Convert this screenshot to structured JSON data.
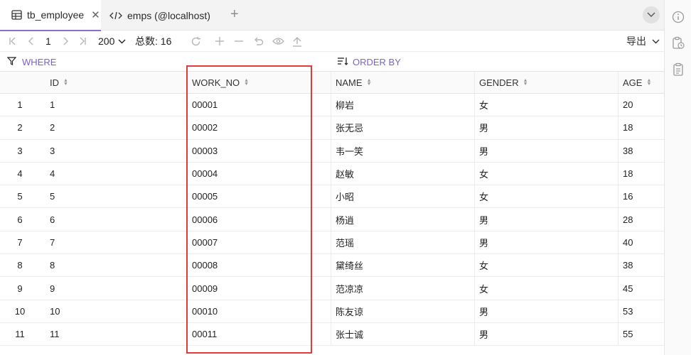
{
  "tabs": [
    {
      "label": "tb_employee",
      "icon": "table-icon",
      "active": true
    },
    {
      "label": "emps (@localhost)",
      "icon": "code-icon",
      "active": false
    }
  ],
  "toolbar": {
    "page_current": "1",
    "page_size": "200",
    "total_label": "总数: 16",
    "export_label": "导出"
  },
  "filter": {
    "where_label": "WHERE",
    "order_label": "ORDER BY"
  },
  "columns": [
    "ID",
    "WORK_NO",
    "NAME",
    "GENDER",
    "AGE"
  ],
  "rows": [
    {
      "idx": "1",
      "id": "1",
      "work_no": "00001",
      "name": "柳岩",
      "gender": "女",
      "age": "20"
    },
    {
      "idx": "2",
      "id": "2",
      "work_no": "00002",
      "name": "张无忌",
      "gender": "男",
      "age": "18"
    },
    {
      "idx": "3",
      "id": "3",
      "work_no": "00003",
      "name": "韦一笑",
      "gender": "男",
      "age": "38"
    },
    {
      "idx": "4",
      "id": "4",
      "work_no": "00004",
      "name": "赵敏",
      "gender": "女",
      "age": "18"
    },
    {
      "idx": "5",
      "id": "5",
      "work_no": "00005",
      "name": "小昭",
      "gender": "女",
      "age": "16"
    },
    {
      "idx": "6",
      "id": "6",
      "work_no": "00006",
      "name": "杨逍",
      "gender": "男",
      "age": "28"
    },
    {
      "idx": "7",
      "id": "7",
      "work_no": "00007",
      "name": "范瑶",
      "gender": "男",
      "age": "40"
    },
    {
      "idx": "8",
      "id": "8",
      "work_no": "00008",
      "name": "黛绮丝",
      "gender": "女",
      "age": "38"
    },
    {
      "idx": "9",
      "id": "9",
      "work_no": "00009",
      "name": "范凉凉",
      "gender": "女",
      "age": "45"
    },
    {
      "idx": "10",
      "id": "10",
      "work_no": "00010",
      "name": "陈友谅",
      "gender": "男",
      "age": "53"
    },
    {
      "idx": "11",
      "id": "11",
      "work_no": "00011",
      "name": "张士诚",
      "gender": "男",
      "age": "55"
    }
  ],
  "colors": {
    "accent": "#7c62c9",
    "highlight": "#e23a3a"
  }
}
